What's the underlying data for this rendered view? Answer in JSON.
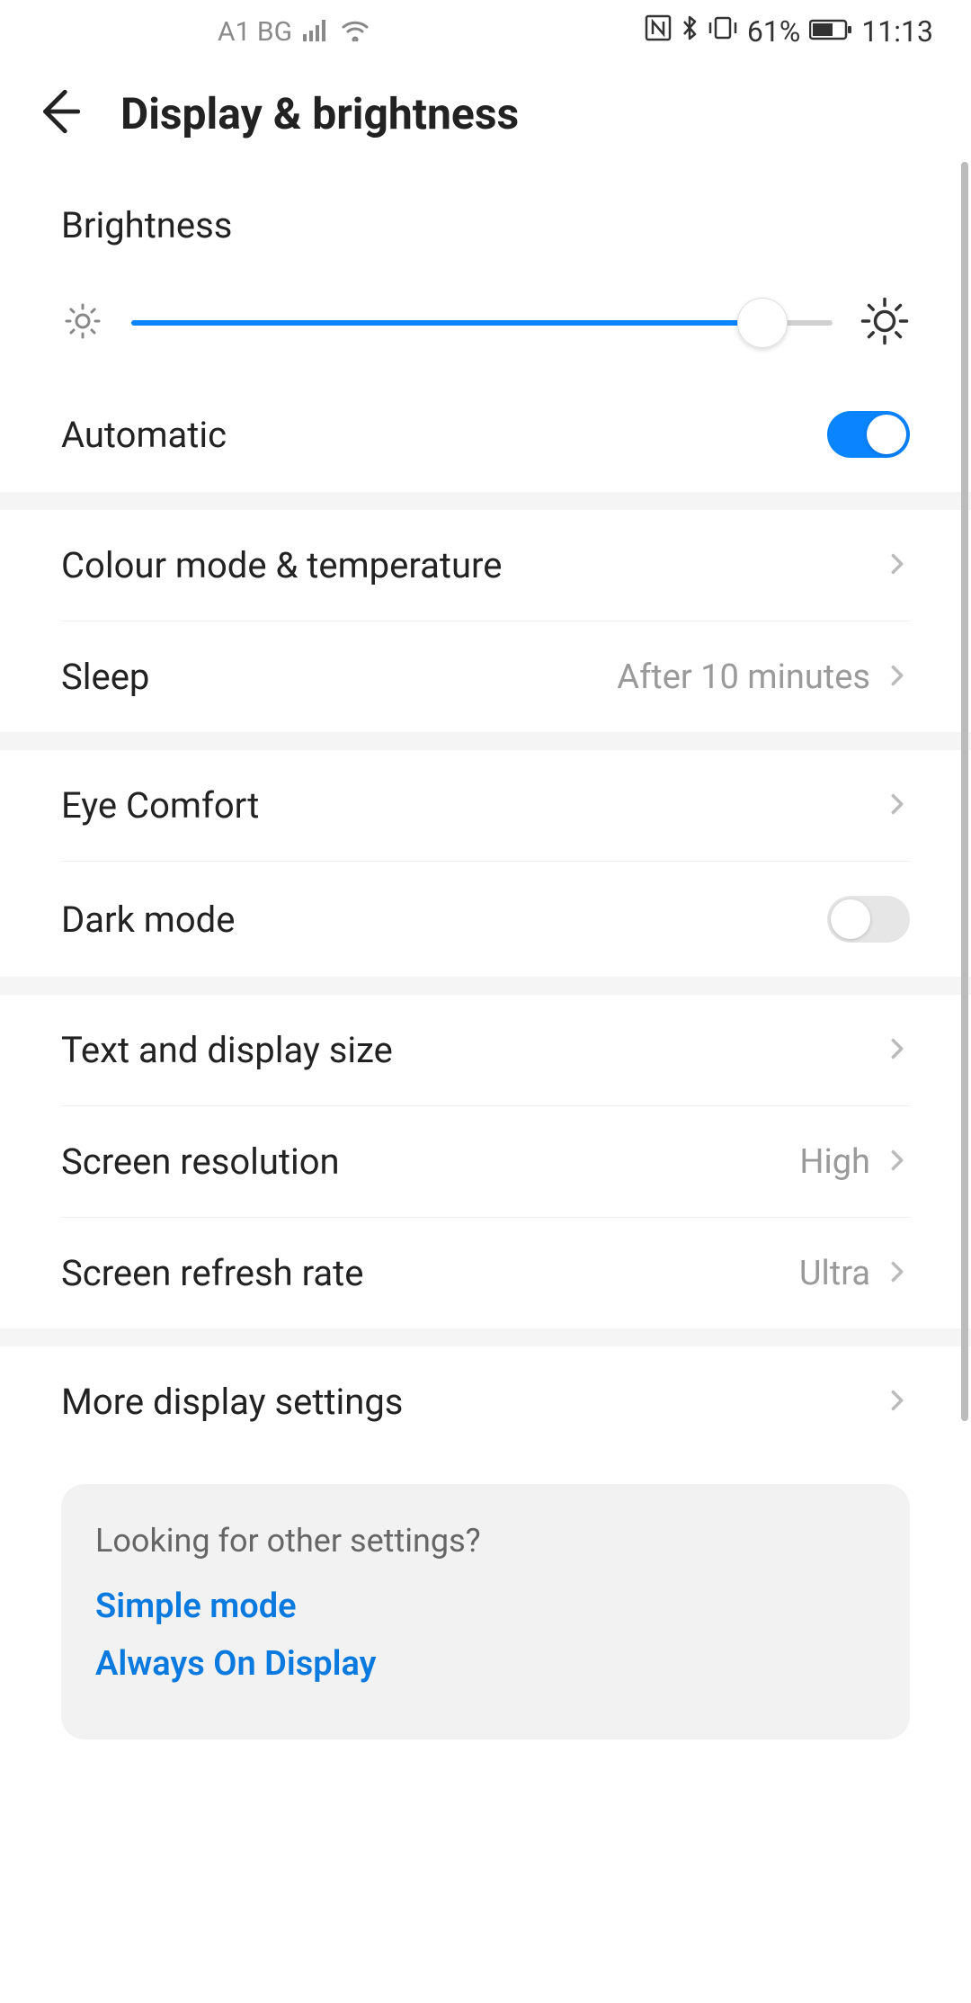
{
  "status": {
    "carrier": "A1 BG",
    "battery": "61%",
    "time": "11:13"
  },
  "header": {
    "title": "Display & brightness"
  },
  "brightness": {
    "label": "Brightness",
    "percent": 90,
    "automatic_label": "Automatic",
    "automatic_on": true
  },
  "items": {
    "colour_mode": {
      "label": "Colour mode & temperature"
    },
    "sleep": {
      "label": "Sleep",
      "value": "After 10 minutes"
    },
    "eye_comfort": {
      "label": "Eye Comfort"
    },
    "dark_mode": {
      "label": "Dark mode",
      "on": false
    },
    "text_size": {
      "label": "Text and display size"
    },
    "resolution": {
      "label": "Screen resolution",
      "value": "High"
    },
    "refresh": {
      "label": "Screen refresh rate",
      "value": "Ultra"
    },
    "more": {
      "label": "More display settings"
    }
  },
  "other": {
    "title": "Looking for other settings?",
    "links": {
      "simple": "Simple mode",
      "aod": "Always On Display"
    }
  }
}
